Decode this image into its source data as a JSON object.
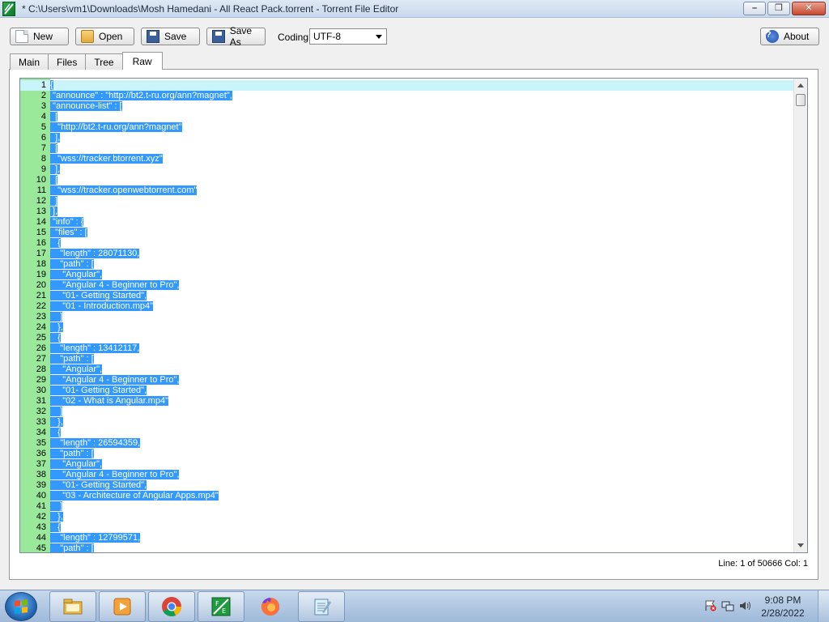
{
  "window": {
    "title": "* C:\\Users\\vm1\\Downloads\\Mosh Hamedani - All React Pack.torrent - Torrent File Editor",
    "minimize": "–",
    "maximize": "❐",
    "close": "✕"
  },
  "toolbar": {
    "new_label": "New",
    "open_label": "Open",
    "save_label": "Save",
    "save_as_label": "Save As",
    "coding_label": "Coding",
    "coding_value": "UTF-8",
    "about_label": "About",
    "about_icon": "?"
  },
  "tabs": [
    {
      "label": "Main"
    },
    {
      "label": "Files"
    },
    {
      "label": "Tree"
    },
    {
      "label": "Raw",
      "active": true
    }
  ],
  "editor": {
    "lines": [
      {
        "n": "1",
        "text": "{"
      },
      {
        "n": "2",
        "text": " \"announce\" : \"http://bt2.t-ru.org/ann?magnet\","
      },
      {
        "n": "3",
        "text": " \"announce-list\" : ["
      },
      {
        "n": "4",
        "text": "  ["
      },
      {
        "n": "5",
        "text": "   \"http://bt2.t-ru.org/ann?magnet\""
      },
      {
        "n": "6",
        "text": "  ],"
      },
      {
        "n": "7",
        "text": "  ["
      },
      {
        "n": "8",
        "text": "   \"wss://tracker.btorrent.xyz\""
      },
      {
        "n": "9",
        "text": "  ],"
      },
      {
        "n": "10",
        "text": "  ["
      },
      {
        "n": "11",
        "text": "   \"wss://tracker.openwebtorrent.com\""
      },
      {
        "n": "12",
        "text": "  ]"
      },
      {
        "n": "13",
        "text": " ],"
      },
      {
        "n": "14",
        "text": " \"info\" : {"
      },
      {
        "n": "15",
        "text": "  \"files\" : ["
      },
      {
        "n": "16",
        "text": "   {"
      },
      {
        "n": "17",
        "text": "    \"length\" : 28071130,"
      },
      {
        "n": "18",
        "text": "    \"path\" : ["
      },
      {
        "n": "19",
        "text": "     \"Angular\","
      },
      {
        "n": "20",
        "text": "     \"Angular 4 - Beginner to Pro\","
      },
      {
        "n": "21",
        "text": "     \"01- Getting Started\","
      },
      {
        "n": "22",
        "text": "     \"01 - Introduction.mp4\""
      },
      {
        "n": "23",
        "text": "    ]"
      },
      {
        "n": "24",
        "text": "   },"
      },
      {
        "n": "25",
        "text": "   {"
      },
      {
        "n": "26",
        "text": "    \"length\" : 13412117,"
      },
      {
        "n": "27",
        "text": "    \"path\" : ["
      },
      {
        "n": "28",
        "text": "     \"Angular\","
      },
      {
        "n": "29",
        "text": "     \"Angular 4 - Beginner to Pro\","
      },
      {
        "n": "30",
        "text": "     \"01- Getting Started\","
      },
      {
        "n": "31",
        "text": "     \"02 - What is Angular.mp4\""
      },
      {
        "n": "32",
        "text": "    ]"
      },
      {
        "n": "33",
        "text": "   },"
      },
      {
        "n": "34",
        "text": "   {"
      },
      {
        "n": "35",
        "text": "    \"length\" : 26594359,"
      },
      {
        "n": "36",
        "text": "    \"path\" : ["
      },
      {
        "n": "37",
        "text": "     \"Angular\","
      },
      {
        "n": "38",
        "text": "     \"Angular 4 - Beginner to Pro\","
      },
      {
        "n": "39",
        "text": "     \"01- Getting Started\","
      },
      {
        "n": "40",
        "text": "     \"03 - Architecture of Angular Apps.mp4\""
      },
      {
        "n": "41",
        "text": "    ]"
      },
      {
        "n": "42",
        "text": "   },"
      },
      {
        "n": "43",
        "text": "   {"
      },
      {
        "n": "44",
        "text": "    \"length\" : 12799571,"
      },
      {
        "n": "45",
        "text": "    \"path\" : ["
      }
    ]
  },
  "status": {
    "position": "Line: 1 of 50666 Col: 1"
  },
  "taskbar": {
    "apps": [
      {
        "icon": "file-explorer-icon"
      },
      {
        "icon": "media-player-icon"
      },
      {
        "icon": "chrome-icon"
      },
      {
        "icon": "torrent-file-editor-icon"
      },
      {
        "icon": "firefox-icon"
      },
      {
        "icon": "notepad-icon"
      }
    ],
    "time": "9:08 PM",
    "date": "2/28/2022"
  },
  "colors": {
    "selection": "#3399ff",
    "gutter": "#9ae89a",
    "current_line": "#c8f4fa"
  }
}
